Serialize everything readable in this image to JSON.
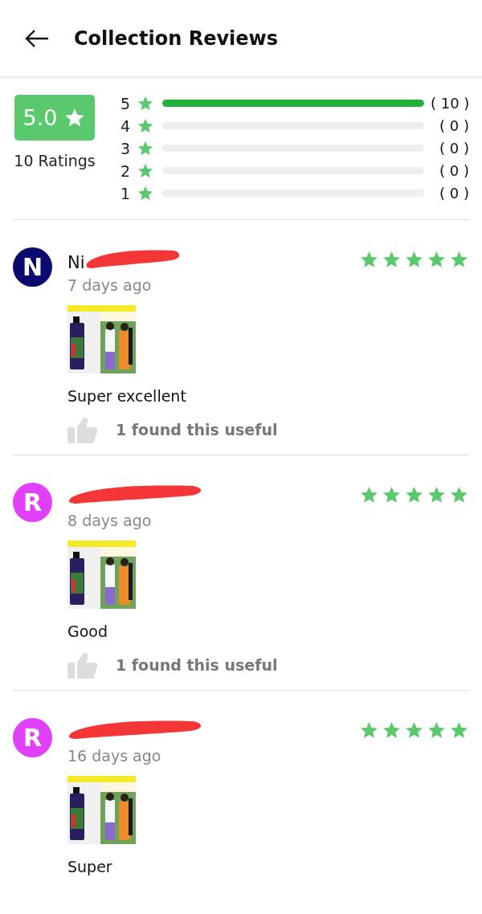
{
  "header": {
    "title": "Collection Reviews"
  },
  "summary": {
    "average": "5.0",
    "ratings_label": "10 Ratings",
    "bars": [
      {
        "star": "5",
        "level": 1,
        "count": "( 10 )"
      },
      {
        "star": "4",
        "level": 0,
        "count": "( 0 )"
      },
      {
        "star": "3",
        "level": 0,
        "count": "( 0 )"
      },
      {
        "star": "2",
        "level": 0,
        "count": "( 0 )"
      },
      {
        "star": "1",
        "level": 0,
        "count": "( 0 )"
      }
    ]
  },
  "reviews": [
    {
      "initial": "N",
      "color": "#0a0a6e",
      "name": "Ni",
      "redacted": true,
      "stars": 5,
      "time": "7 days ago",
      "images": [
        {
          "kind": "picture"
        }
      ],
      "text": "Super excellent",
      "useful": "1 found this useful"
    },
    {
      "initial": "R",
      "color": "#e040fb",
      "redacted": true,
      "stars": 5,
      "time": "8 days ago",
      "images": [
        {
          "kind": "picture"
        }
      ],
      "text": "Good",
      "useful": "1 found this useful"
    },
    {
      "initial": "R",
      "color": "#e040fb",
      "redacted": true,
      "stars": 5,
      "time": "16 days ago",
      "images": [
        {
          "kind": "picture"
        }
      ],
      "text": "Super"
    }
  ]
}
